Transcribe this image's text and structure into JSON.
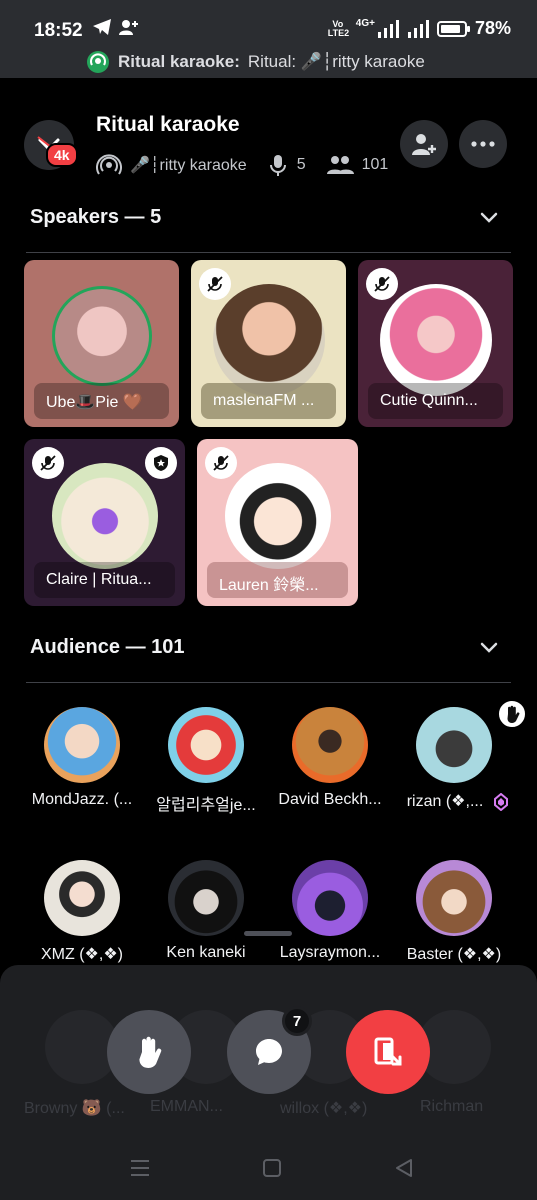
{
  "status_bar": {
    "time": "18:52",
    "battery": "78%",
    "net_label": "Vo LTE2",
    "net_type": "4G+",
    "notification_bold": "Ritual karaoke:",
    "notification_text": "Ritual: 🎤┆ritty karaoke"
  },
  "header": {
    "title": "Ritual karaoke",
    "badge": "4k",
    "channel": "🎤┆ritty karaoke",
    "speaker_count": "5",
    "listener_count": "101"
  },
  "speakers": {
    "heading": "Speakers — 5",
    "tiles": [
      {
        "name": "Ube🎩Pie 🤎",
        "bg": "#b0726a",
        "muted": false,
        "speaking": true
      },
      {
        "name": "maslenaFM ...",
        "bg": "#ebe3c2",
        "muted": true
      },
      {
        "name": "Cutie Quinn...",
        "bg": "#4a2238",
        "muted": true
      },
      {
        "name": "Claire | Ritua...",
        "bg": "#2e1b33",
        "muted": true,
        "moderator": true
      },
      {
        "name": "Lauren 鈴榮...",
        "bg": "#f5c3c3",
        "muted": true
      }
    ]
  },
  "audience": {
    "heading": "Audience — 101",
    "members": [
      {
        "name": "MondJazz. (...",
        "bg": "#e9a25c"
      },
      {
        "name": "알럽리추얼je...",
        "bg": "#7fd0e8"
      },
      {
        "name": "David Beckh...",
        "bg": "#c9833c"
      },
      {
        "name": "rizan (❖,...",
        "bg": "#a8d8e0",
        "hand_raised": true
      },
      {
        "name": "XMZ (❖,❖)",
        "bg": "#e8e4dc"
      },
      {
        "name": "Ken kaneki",
        "bg": "#2a2d33"
      },
      {
        "name": "Laysraymon...",
        "bg": "#6b3fa8"
      },
      {
        "name": "Baster (❖,❖)",
        "bg": "#b889d6"
      }
    ],
    "hidden_row": [
      "Browny 🐻 (...",
      "EMMAN...",
      "willox (❖,❖)",
      "Richman"
    ]
  },
  "controls": {
    "chat_badge": "7",
    "raise_hand_color": "#4e5058",
    "chat_color": "#4e5058",
    "leave_color": "#f23f43"
  }
}
